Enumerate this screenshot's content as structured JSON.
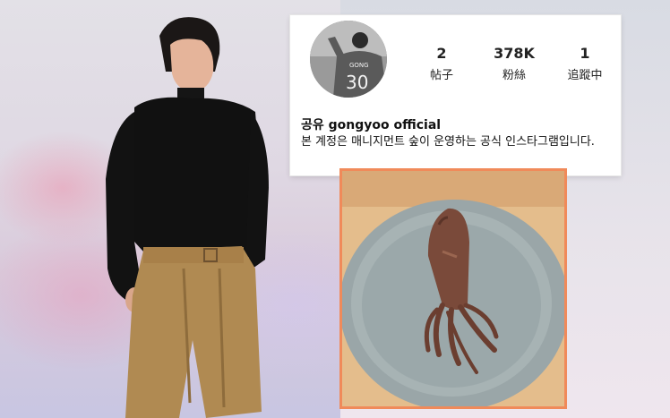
{
  "profile": {
    "stats": [
      {
        "value": "2",
        "label": "帖子"
      },
      {
        "value": "378K",
        "label": "粉絲"
      },
      {
        "value": "1",
        "label": "追蹤中"
      }
    ],
    "name": "공유 gongyoo official",
    "bio": "본 계정은 매니지먼트 숲이 운영하는 공식 인스타그램입니다.",
    "avatar_jersey_name": "GONG",
    "avatar_jersey_number": "30"
  },
  "colors": {
    "card_border": "#e6e6e6",
    "photo_frame": "#f08a5a"
  }
}
